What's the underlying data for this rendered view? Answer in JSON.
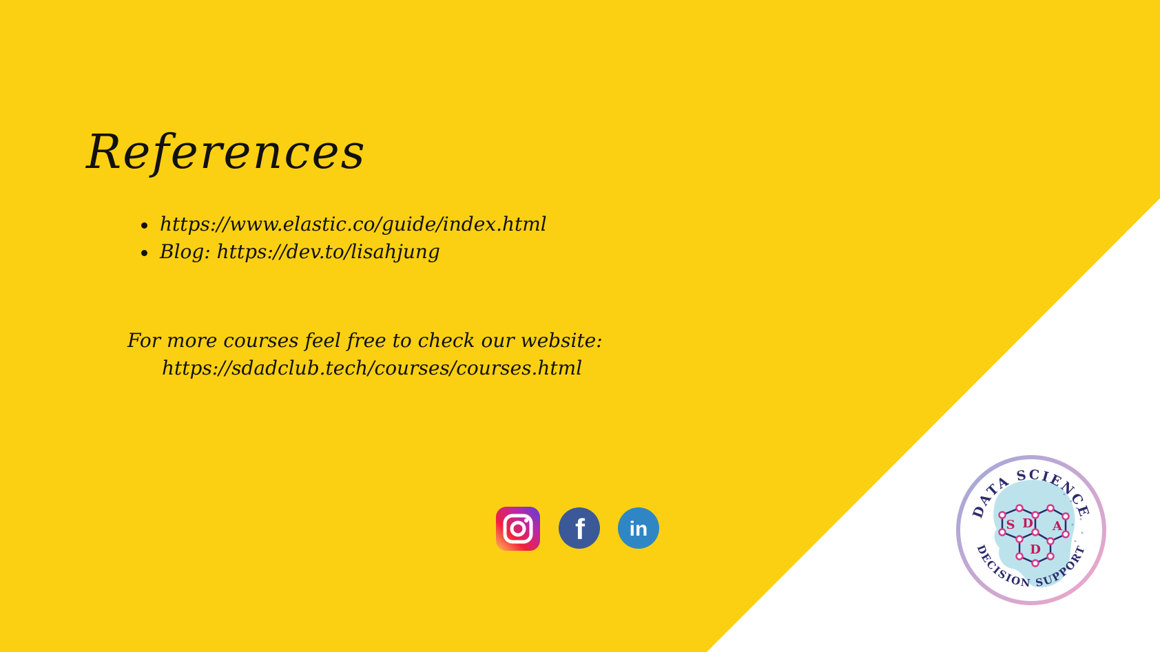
{
  "slide": {
    "title": "References",
    "references": [
      "https://www.elastic.co/guide/index.html",
      "Blog: https://dev.to/lisahjung"
    ],
    "more_text": "For more courses feel free to check our website:",
    "website_url": "https://sdadclub.tech/courses/courses.html"
  },
  "social": [
    {
      "icon": "instagram-icon"
    },
    {
      "icon": "facebook-icon",
      "glyph": "f"
    },
    {
      "icon": "linkedin-icon",
      "glyph": "in"
    }
  ],
  "logo": {
    "top_text": "DATA SCIENCE",
    "bottom_text": "DECISION SUPPORT",
    "letters": [
      "S",
      "D",
      "A",
      "D"
    ]
  },
  "colors": {
    "background_yellow": "#FCD012",
    "background_white": "#FFFFFF",
    "text": "#111111",
    "facebook_blue": "#3B5998",
    "linkedin_blue": "#2F86C4"
  }
}
